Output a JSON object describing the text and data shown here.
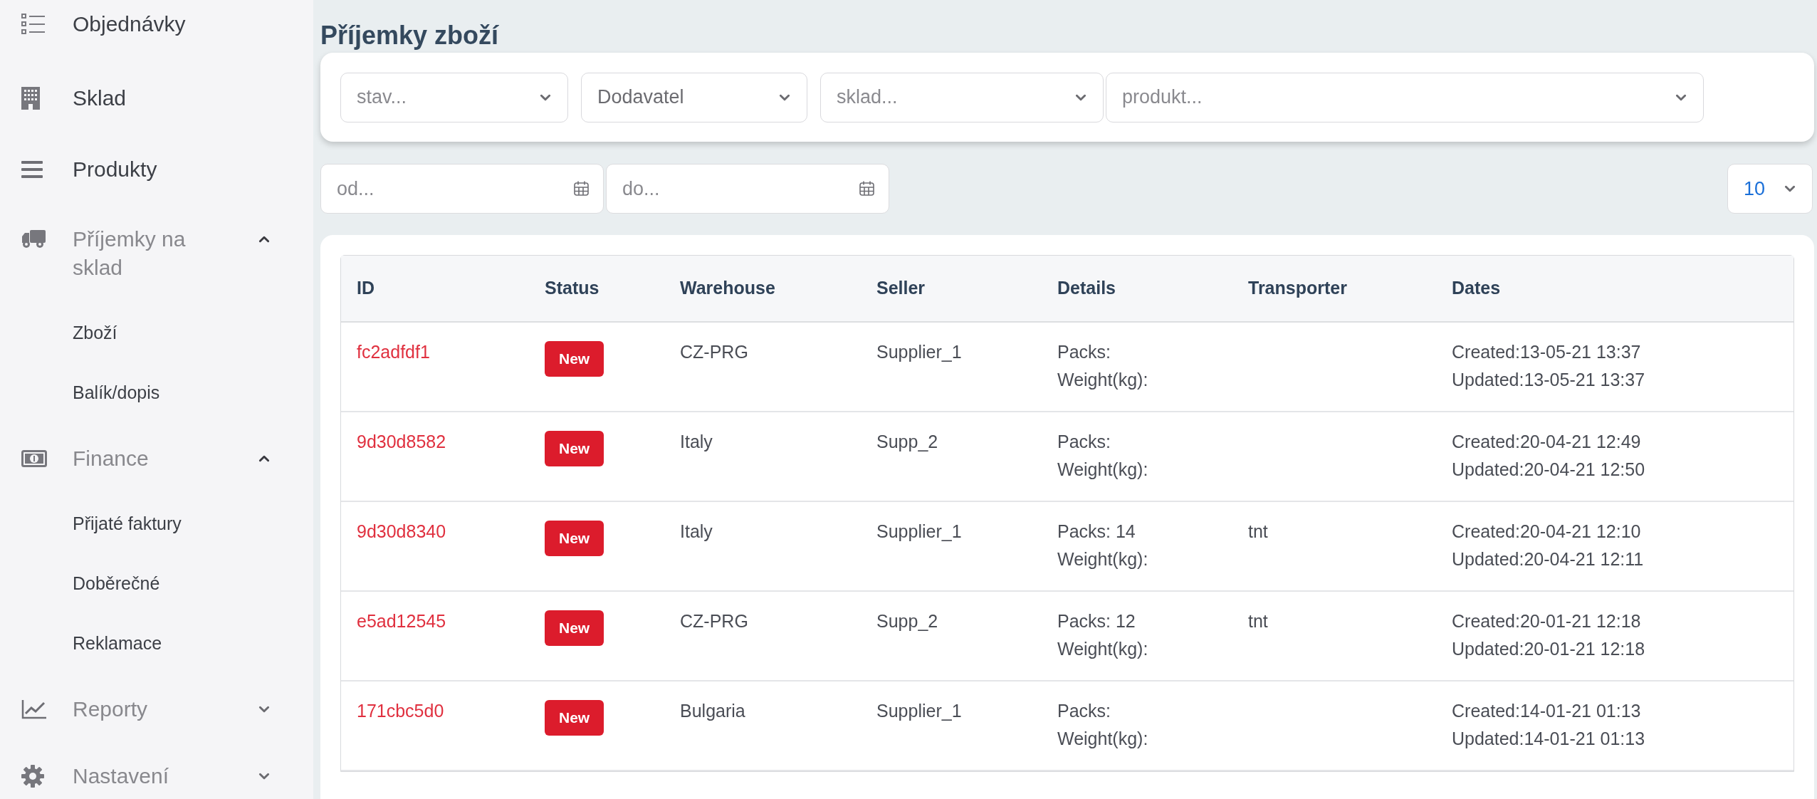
{
  "sidebar": {
    "items": [
      {
        "kind": "link",
        "label": "Objednávky"
      },
      {
        "kind": "link",
        "label": "Sklad"
      },
      {
        "kind": "link",
        "label": "Produkty"
      },
      {
        "kind": "group",
        "label": "Příjemky na sklad",
        "expanded": true,
        "children": [
          {
            "label": "Zboží"
          },
          {
            "label": "Balík/dopis"
          }
        ]
      },
      {
        "kind": "group",
        "label": "Finance",
        "expanded": true,
        "children": [
          {
            "label": "Přijaté faktury"
          },
          {
            "label": "Doběrečné"
          },
          {
            "label": "Reklamace"
          }
        ]
      },
      {
        "kind": "group",
        "label": "Reporty",
        "expanded": false
      },
      {
        "kind": "group",
        "label": "Nastavení",
        "expanded": false
      }
    ]
  },
  "page_title": "Příjemky zboží",
  "filters": {
    "selects": [
      {
        "placeholder": "stav..."
      },
      {
        "value": "Dodavatel"
      },
      {
        "placeholder": "sklad..."
      },
      {
        "placeholder": "produkt..."
      }
    ],
    "date_from": {
      "placeholder": "od..."
    },
    "date_to": {
      "placeholder": "do..."
    },
    "page_size": "10"
  },
  "table": {
    "columns": [
      "ID",
      "Status",
      "Warehouse",
      "Seller",
      "Details",
      "Transporter",
      "Dates"
    ],
    "rows": [
      {
        "id": "fc2adfdf1",
        "status": "New",
        "warehouse": "CZ-PRG",
        "seller": "Supplier_1",
        "packs": "Packs:",
        "weight": "Weight(kg):",
        "created": "Created:13-05-21 13:37",
        "updated": "Updated:13-05-21 13:37"
      },
      {
        "id": "9d30d8582",
        "status": "New",
        "warehouse": "Italy",
        "seller": "Supp_2",
        "packs": "Packs:",
        "weight": "Weight(kg):",
        "created": "Created:20-04-21 12:49",
        "updated": "Updated:20-04-21 12:50"
      },
      {
        "id": "9d30d8340",
        "status": "New",
        "warehouse": "Italy",
        "seller": "Supplier_1",
        "packs": "Packs: 14",
        "weight": "Weight(kg):",
        "transporter": "tnt",
        "created": "Created:20-04-21 12:10",
        "updated": "Updated:20-04-21 12:11"
      },
      {
        "id": "e5ad12545",
        "status": "New",
        "warehouse": "CZ-PRG",
        "seller": "Supp_2",
        "packs": "Packs: 12",
        "weight": "Weight(kg):",
        "transporter": "tnt",
        "created": "Created:20-01-21 12:18",
        "updated": "Updated:20-01-21 12:18"
      },
      {
        "id": "171cbc5d0",
        "status": "New",
        "warehouse": "Bulgaria",
        "seller": "Supplier_1",
        "packs": "Packs:",
        "weight": "Weight(kg):",
        "created": "Created:14-01-21 01:13",
        "updated": "Updated:14-01-21 01:13"
      }
    ]
  }
}
